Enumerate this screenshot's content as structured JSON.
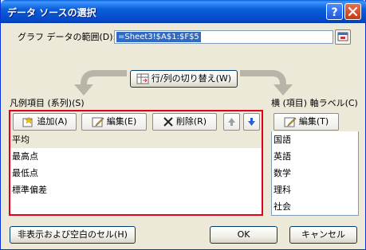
{
  "window": {
    "title": "データ ソースの選択"
  },
  "range": {
    "label": "グラフ データの範囲(D):",
    "value": "=Sheet3!$A$1:$F$5"
  },
  "switch_button": "行/列の切り替え(W)",
  "legend": {
    "label": "凡例項目 (系列)(S)",
    "add_label": "追加(A)",
    "edit_label": "編集(E)",
    "delete_label": "削除(R)",
    "items": [
      "平均",
      "最高点",
      "最低点",
      "標準偏差"
    ]
  },
  "axis": {
    "label": "横 (項目) 軸ラベル(C)",
    "edit_label": "編集(T)",
    "items": [
      "国語",
      "英語",
      "数学",
      "理科",
      "社会"
    ]
  },
  "footer": {
    "hidden_cells_label": "非表示および空白のセル(H)",
    "ok_label": "OK",
    "cancel_label": "キャンセル"
  },
  "colors": {
    "title_bar": "#0a5fd8",
    "highlight_box": "#e3001b",
    "selection": "#316ac5"
  }
}
